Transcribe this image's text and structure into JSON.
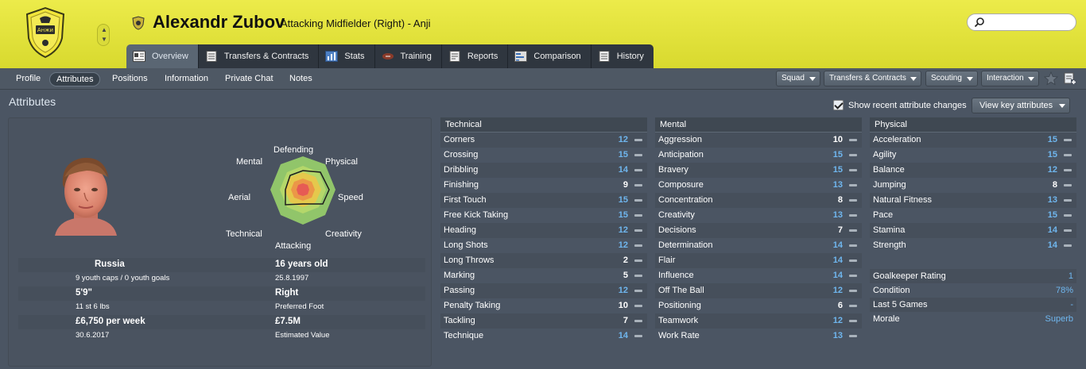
{
  "header": {
    "player_name": "Alexandr Zubov",
    "player_role": "Attacking Midfielder (Right) - Anji",
    "search_placeholder": ""
  },
  "main_tabs": [
    {
      "label": "Overview",
      "icon": "overview-icon",
      "active": true
    },
    {
      "label": "Transfers & Contracts",
      "icon": "document-icon",
      "active": false
    },
    {
      "label": "Stats",
      "icon": "stats-icon",
      "active": false
    },
    {
      "label": "Training",
      "icon": "training-ball-icon",
      "active": false
    },
    {
      "label": "Reports",
      "icon": "reports-icon",
      "active": false
    },
    {
      "label": "Comparison",
      "icon": "comparison-icon",
      "active": false
    },
    {
      "label": "History",
      "icon": "history-icon",
      "active": false
    }
  ],
  "sub_nav": [
    {
      "label": "Profile",
      "active": false
    },
    {
      "label": "Attributes",
      "active": true
    },
    {
      "label": "Positions",
      "active": false
    },
    {
      "label": "Information",
      "active": false
    },
    {
      "label": "Private Chat",
      "active": false
    },
    {
      "label": "Notes",
      "active": false
    }
  ],
  "dropdowns": [
    {
      "label": "Squad"
    },
    {
      "label": "Transfers & Contracts"
    },
    {
      "label": "Scouting"
    },
    {
      "label": "Interaction"
    }
  ],
  "page": {
    "title": "Attributes",
    "recent_changes_label": "Show recent attribute changes",
    "recent_changes_checked": true,
    "view_key_label": "View key attributes"
  },
  "radar": {
    "labels": [
      "Defending",
      "Physical",
      "Speed",
      "Creativity",
      "Attacking",
      "Technical",
      "Aerial",
      "Mental"
    ]
  },
  "bio": {
    "nation": "Russia",
    "youth_caps": "9 youth caps / 0 youth goals",
    "height": "5'9\"",
    "weight": "11 st 6 lbs",
    "wage": "£6,750 per week",
    "contract_end": "30.6.2017",
    "age": "16 years old",
    "dob": "25.8.1997",
    "foot": "Right",
    "foot_label": "Preferred Foot",
    "value": "£7.5M",
    "value_label": "Estimated Value"
  },
  "attributes": {
    "technical": {
      "title": "Technical",
      "rows": [
        {
          "name": "Corners",
          "value": "12"
        },
        {
          "name": "Crossing",
          "value": "15"
        },
        {
          "name": "Dribbling",
          "value": "14"
        },
        {
          "name": "Finishing",
          "value": "9"
        },
        {
          "name": "First Touch",
          "value": "15"
        },
        {
          "name": "Free Kick Taking",
          "value": "15"
        },
        {
          "name": "Heading",
          "value": "12"
        },
        {
          "name": "Long Shots",
          "value": "12"
        },
        {
          "name": "Long Throws",
          "value": "2"
        },
        {
          "name": "Marking",
          "value": "5"
        },
        {
          "name": "Passing",
          "value": "12"
        },
        {
          "name": "Penalty Taking",
          "value": "10"
        },
        {
          "name": "Tackling",
          "value": "7"
        },
        {
          "name": "Technique",
          "value": "14"
        }
      ]
    },
    "mental": {
      "title": "Mental",
      "rows": [
        {
          "name": "Aggression",
          "value": "10"
        },
        {
          "name": "Anticipation",
          "value": "15"
        },
        {
          "name": "Bravery",
          "value": "15"
        },
        {
          "name": "Composure",
          "value": "13"
        },
        {
          "name": "Concentration",
          "value": "8"
        },
        {
          "name": "Creativity",
          "value": "13"
        },
        {
          "name": "Decisions",
          "value": "7"
        },
        {
          "name": "Determination",
          "value": "14"
        },
        {
          "name": "Flair",
          "value": "14"
        },
        {
          "name": "Influence",
          "value": "14"
        },
        {
          "name": "Off The Ball",
          "value": "12"
        },
        {
          "name": "Positioning",
          "value": "6"
        },
        {
          "name": "Teamwork",
          "value": "12"
        },
        {
          "name": "Work Rate",
          "value": "13"
        }
      ]
    },
    "physical": {
      "title": "Physical",
      "rows": [
        {
          "name": "Acceleration",
          "value": "15"
        },
        {
          "name": "Agility",
          "value": "15"
        },
        {
          "name": "Balance",
          "value": "12"
        },
        {
          "name": "Jumping",
          "value": "8"
        },
        {
          "name": "Natural Fitness",
          "value": "13"
        },
        {
          "name": "Pace",
          "value": "15"
        },
        {
          "name": "Stamina",
          "value": "14"
        },
        {
          "name": "Strength",
          "value": "14"
        }
      ],
      "extra": [
        {
          "name": "Goalkeeper Rating",
          "value": "1"
        },
        {
          "name": "Condition",
          "value": "78%"
        },
        {
          "name": "Last 5 Games",
          "value": "-"
        },
        {
          "name": "Morale",
          "value": "Superb"
        }
      ]
    }
  },
  "colors": {
    "header_yellow": "#e3e33c",
    "value_blue": "#6fb6ee",
    "value_white": "#ffffff",
    "radar_green": "#8fc46a"
  }
}
